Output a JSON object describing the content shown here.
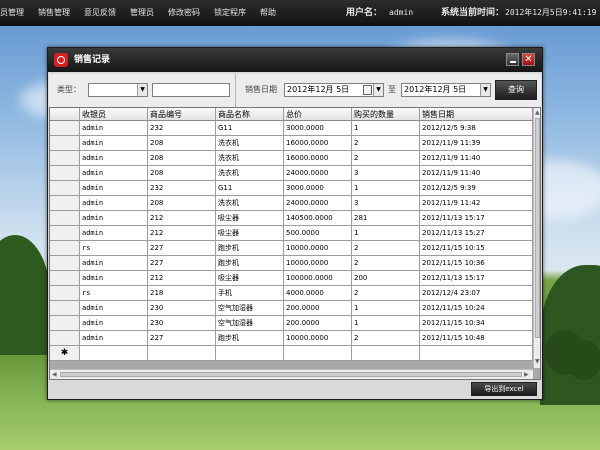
{
  "menu": {
    "items": [
      "员管理",
      "销售管理",
      "意见反馈",
      "管理员",
      "修改密码",
      "锁定程序",
      "帮助"
    ],
    "user_label": "用户名：",
    "user_value": "admin",
    "time_label": "系统当前时间：",
    "time_value": "2012年12月5日9:41:19"
  },
  "dialog": {
    "title": "销售记录",
    "close_glyph": "✕"
  },
  "filters": {
    "type_label": "类型：",
    "type_value": "",
    "keyword_value": "",
    "date_label": "销售日期",
    "date_from": "2012年12月 5日",
    "to_label": "至",
    "date_to": "2012年12月 5日",
    "query_button": "查询"
  },
  "grid": {
    "columns": [
      "收银员",
      "商品编号",
      "商品名称",
      "总价",
      "购买的数量",
      "销售日期"
    ],
    "rows": [
      [
        "admin",
        "232",
        "G11",
        "3000.0000",
        "1",
        "2012/12/5 9:38"
      ],
      [
        "admin",
        "208",
        "洗衣机",
        "16000.0000",
        "2",
        "2012/11/9 11:39"
      ],
      [
        "admin",
        "208",
        "洗衣机",
        "16000.0000",
        "2",
        "2012/11/9 11:40"
      ],
      [
        "admin",
        "208",
        "洗衣机",
        "24000.0000",
        "3",
        "2012/11/9 11:40"
      ],
      [
        "admin",
        "232",
        "G11",
        "3000.0000",
        "1",
        "2012/12/5 9:39"
      ],
      [
        "admin",
        "208",
        "洗衣机",
        "24000.0000",
        "3",
        "2012/11/9 11:42"
      ],
      [
        "admin",
        "212",
        "吸尘器",
        "140500.0000",
        "281",
        "2012/11/13 15:17"
      ],
      [
        "admin",
        "212",
        "吸尘器",
        "500.0000",
        "1",
        "2012/11/13 15:27"
      ],
      [
        "rs",
        "227",
        "跑步机",
        "10000.0000",
        "2",
        "2012/11/15 10:15"
      ],
      [
        "admin",
        "227",
        "跑步机",
        "10000.0000",
        "2",
        "2012/11/15 10:36"
      ],
      [
        "admin",
        "212",
        "吸尘器",
        "100000.0000",
        "200",
        "2012/11/13 15:17"
      ],
      [
        "rs",
        "218",
        "手机",
        "4000.0000",
        "2",
        "2012/12/4 23:07"
      ],
      [
        "admin",
        "230",
        "空气加湿器",
        "200.0000",
        "1",
        "2012/11/15 10:24"
      ],
      [
        "admin",
        "230",
        "空气加湿器",
        "200.0000",
        "1",
        "2012/11/15 10:34"
      ],
      [
        "admin",
        "227",
        "跑步机",
        "10000.0000",
        "2",
        "2012/11/15 10:48"
      ]
    ],
    "new_row_marker": "✱"
  },
  "export_button": "导出到excel"
}
